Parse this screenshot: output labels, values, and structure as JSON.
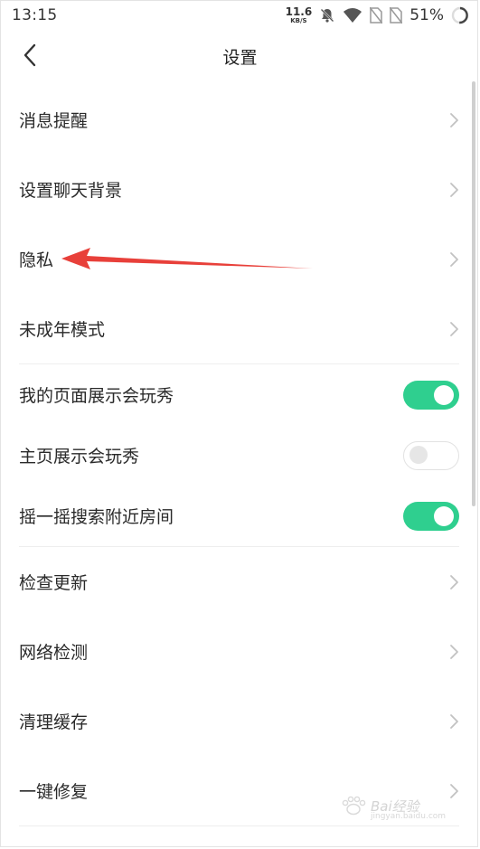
{
  "status_bar": {
    "time": "13:15",
    "net_speed_value": "11.6",
    "net_speed_unit": "KB/S",
    "battery": "51%"
  },
  "header": {
    "title": "设置"
  },
  "settings": {
    "items": [
      {
        "label": "消息提醒"
      },
      {
        "label": "设置聊天背景"
      },
      {
        "label": "隐私"
      },
      {
        "label": "未成年模式"
      },
      {
        "label": "我的页面展示会玩秀",
        "toggle": true
      },
      {
        "label": "主页展示会玩秀",
        "toggle": false
      },
      {
        "label": "摇一摇搜索附近房间",
        "toggle": true
      },
      {
        "label": "检查更新"
      },
      {
        "label": "网络检测"
      },
      {
        "label": "清理缓存"
      },
      {
        "label": "一键修复"
      }
    ]
  },
  "annotation": {
    "color": "#e8403a"
  },
  "colors": {
    "toggle_on": "#2fcf8f",
    "toggle_off": "#e6e6e6"
  },
  "watermark": {
    "text": "Bai经验",
    "sub": "jingyan.baidu.com"
  }
}
